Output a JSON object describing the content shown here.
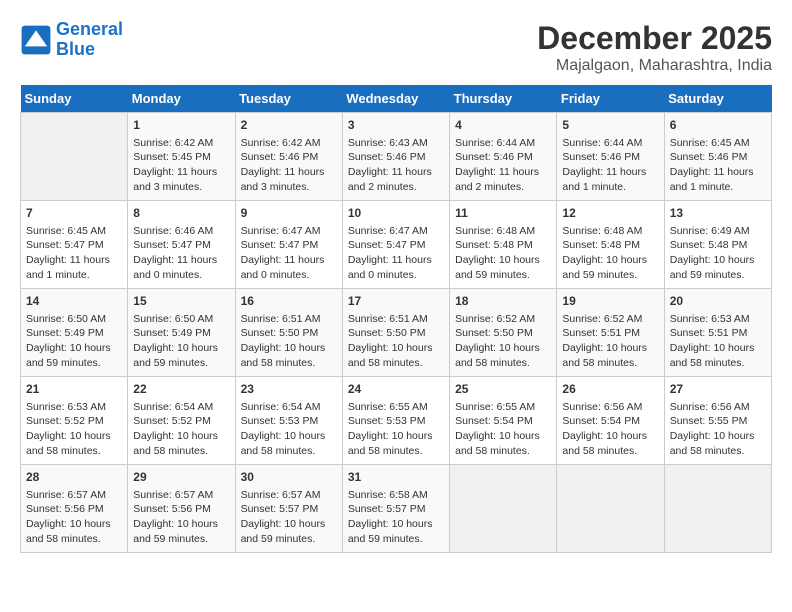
{
  "header": {
    "logo_line1": "General",
    "logo_line2": "Blue",
    "month_title": "December 2025",
    "location": "Majalgaon, Maharashtra, India"
  },
  "weekdays": [
    "Sunday",
    "Monday",
    "Tuesday",
    "Wednesday",
    "Thursday",
    "Friday",
    "Saturday"
  ],
  "weeks": [
    [
      {
        "day": "",
        "info": ""
      },
      {
        "day": "1",
        "info": "Sunrise: 6:42 AM\nSunset: 5:45 PM\nDaylight: 11 hours\nand 3 minutes."
      },
      {
        "day": "2",
        "info": "Sunrise: 6:42 AM\nSunset: 5:46 PM\nDaylight: 11 hours\nand 3 minutes."
      },
      {
        "day": "3",
        "info": "Sunrise: 6:43 AM\nSunset: 5:46 PM\nDaylight: 11 hours\nand 2 minutes."
      },
      {
        "day": "4",
        "info": "Sunrise: 6:44 AM\nSunset: 5:46 PM\nDaylight: 11 hours\nand 2 minutes."
      },
      {
        "day": "5",
        "info": "Sunrise: 6:44 AM\nSunset: 5:46 PM\nDaylight: 11 hours\nand 1 minute."
      },
      {
        "day": "6",
        "info": "Sunrise: 6:45 AM\nSunset: 5:46 PM\nDaylight: 11 hours\nand 1 minute."
      }
    ],
    [
      {
        "day": "7",
        "info": "Sunrise: 6:45 AM\nSunset: 5:47 PM\nDaylight: 11 hours\nand 1 minute."
      },
      {
        "day": "8",
        "info": "Sunrise: 6:46 AM\nSunset: 5:47 PM\nDaylight: 11 hours\nand 0 minutes."
      },
      {
        "day": "9",
        "info": "Sunrise: 6:47 AM\nSunset: 5:47 PM\nDaylight: 11 hours\nand 0 minutes."
      },
      {
        "day": "10",
        "info": "Sunrise: 6:47 AM\nSunset: 5:47 PM\nDaylight: 11 hours\nand 0 minutes."
      },
      {
        "day": "11",
        "info": "Sunrise: 6:48 AM\nSunset: 5:48 PM\nDaylight: 10 hours\nand 59 minutes."
      },
      {
        "day": "12",
        "info": "Sunrise: 6:48 AM\nSunset: 5:48 PM\nDaylight: 10 hours\nand 59 minutes."
      },
      {
        "day": "13",
        "info": "Sunrise: 6:49 AM\nSunset: 5:48 PM\nDaylight: 10 hours\nand 59 minutes."
      }
    ],
    [
      {
        "day": "14",
        "info": "Sunrise: 6:50 AM\nSunset: 5:49 PM\nDaylight: 10 hours\nand 59 minutes."
      },
      {
        "day": "15",
        "info": "Sunrise: 6:50 AM\nSunset: 5:49 PM\nDaylight: 10 hours\nand 59 minutes."
      },
      {
        "day": "16",
        "info": "Sunrise: 6:51 AM\nSunset: 5:50 PM\nDaylight: 10 hours\nand 58 minutes."
      },
      {
        "day": "17",
        "info": "Sunrise: 6:51 AM\nSunset: 5:50 PM\nDaylight: 10 hours\nand 58 minutes."
      },
      {
        "day": "18",
        "info": "Sunrise: 6:52 AM\nSunset: 5:50 PM\nDaylight: 10 hours\nand 58 minutes."
      },
      {
        "day": "19",
        "info": "Sunrise: 6:52 AM\nSunset: 5:51 PM\nDaylight: 10 hours\nand 58 minutes."
      },
      {
        "day": "20",
        "info": "Sunrise: 6:53 AM\nSunset: 5:51 PM\nDaylight: 10 hours\nand 58 minutes."
      }
    ],
    [
      {
        "day": "21",
        "info": "Sunrise: 6:53 AM\nSunset: 5:52 PM\nDaylight: 10 hours\nand 58 minutes."
      },
      {
        "day": "22",
        "info": "Sunrise: 6:54 AM\nSunset: 5:52 PM\nDaylight: 10 hours\nand 58 minutes."
      },
      {
        "day": "23",
        "info": "Sunrise: 6:54 AM\nSunset: 5:53 PM\nDaylight: 10 hours\nand 58 minutes."
      },
      {
        "day": "24",
        "info": "Sunrise: 6:55 AM\nSunset: 5:53 PM\nDaylight: 10 hours\nand 58 minutes."
      },
      {
        "day": "25",
        "info": "Sunrise: 6:55 AM\nSunset: 5:54 PM\nDaylight: 10 hours\nand 58 minutes."
      },
      {
        "day": "26",
        "info": "Sunrise: 6:56 AM\nSunset: 5:54 PM\nDaylight: 10 hours\nand 58 minutes."
      },
      {
        "day": "27",
        "info": "Sunrise: 6:56 AM\nSunset: 5:55 PM\nDaylight: 10 hours\nand 58 minutes."
      }
    ],
    [
      {
        "day": "28",
        "info": "Sunrise: 6:57 AM\nSunset: 5:56 PM\nDaylight: 10 hours\nand 58 minutes."
      },
      {
        "day": "29",
        "info": "Sunrise: 6:57 AM\nSunset: 5:56 PM\nDaylight: 10 hours\nand 59 minutes."
      },
      {
        "day": "30",
        "info": "Sunrise: 6:57 AM\nSunset: 5:57 PM\nDaylight: 10 hours\nand 59 minutes."
      },
      {
        "day": "31",
        "info": "Sunrise: 6:58 AM\nSunset: 5:57 PM\nDaylight: 10 hours\nand 59 minutes."
      },
      {
        "day": "",
        "info": ""
      },
      {
        "day": "",
        "info": ""
      },
      {
        "day": "",
        "info": ""
      }
    ]
  ]
}
